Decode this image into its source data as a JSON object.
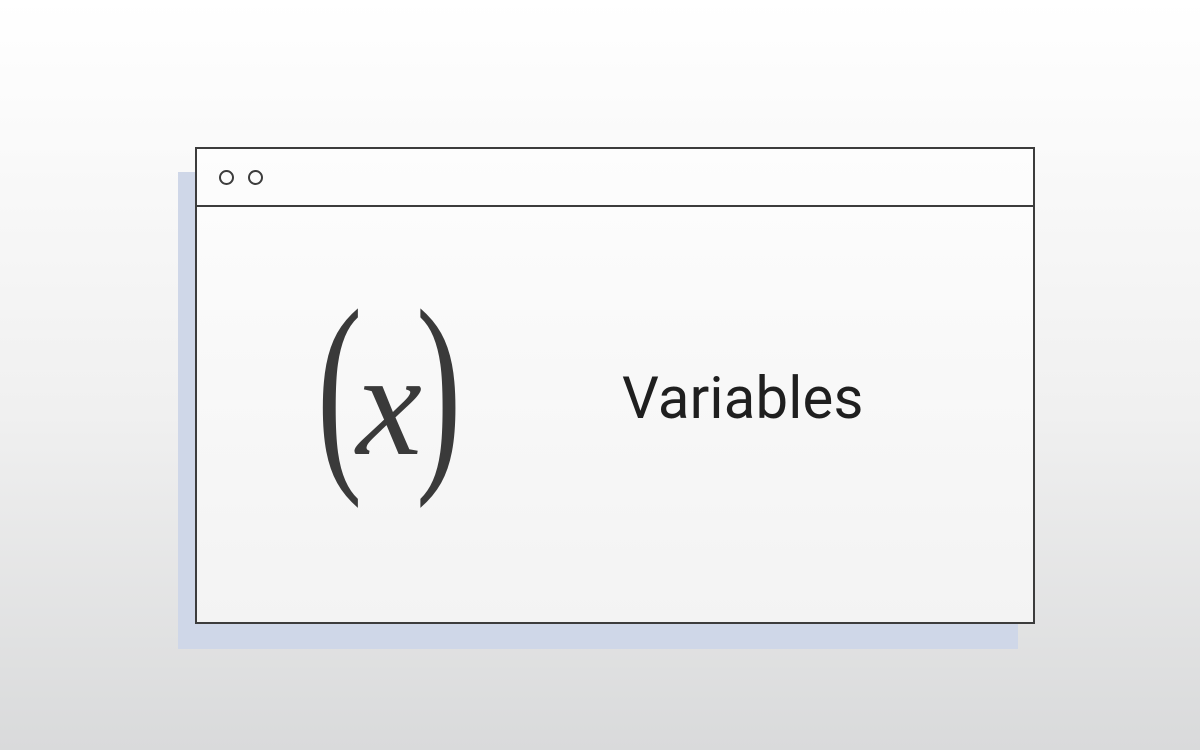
{
  "card": {
    "icon_name": "variable-x-icon",
    "icon_left_paren": "(",
    "icon_x": "x",
    "icon_right_paren": ")",
    "label": "Variables"
  }
}
